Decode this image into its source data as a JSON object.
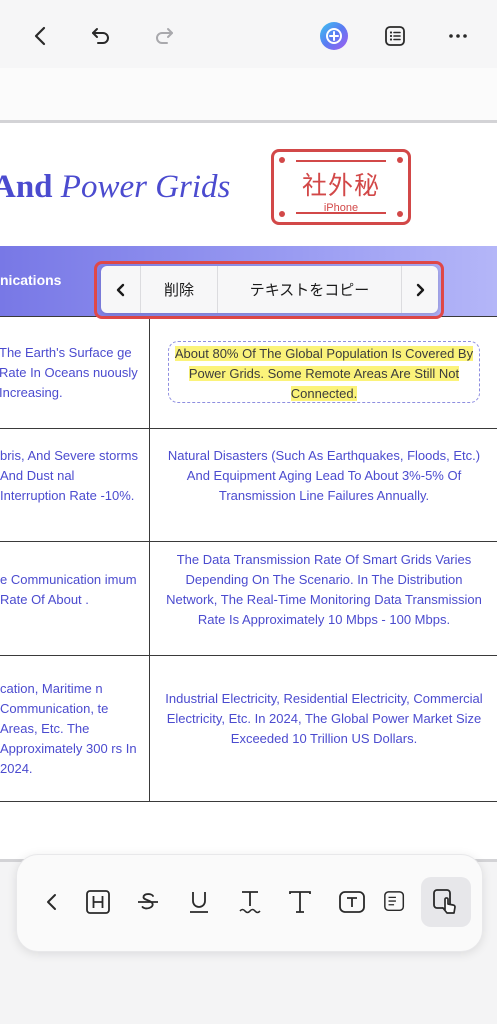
{
  "toolbar_top": {
    "back_icon": "chevron-left-icon",
    "undo_icon": "undo-icon",
    "redo_icon": "redo-icon",
    "ai_icon": "ai-assistant-icon",
    "outline_icon": "list-icon",
    "more_icon": "more-icon"
  },
  "document": {
    "heading_bold": "And",
    "heading_italic": "Power Grids",
    "stamp_main": "社外秘",
    "stamp_sub": "iPhone",
    "table_header_left": "nications",
    "rows": [
      {
        "left": "The Earth's Surface ge Rate In Oceans nuously Increasing.",
        "right": "About 80% Of The Global Population Is Covered By Power Grids. Some Remote Areas Are Still Not Connected."
      },
      {
        "left": "bris, And Severe storms And Dust nal Interruption Rate -10%.",
        "right": "Natural Disasters (Such As Earthquakes, Floods, Etc.) And Equipment Aging Lead To About 3%-5% Of Transmission Line Failures Annually."
      },
      {
        "left": "e Communication imum Rate Of About .",
        "right": "The Data Transmission Rate Of Smart Grids Varies Depending On The Scenario. In The Distribution Network, The Real-Time Monitoring Data Transmission Rate Is Approximately 10 Mbps - 100 Mbps."
      },
      {
        "left": "cation, Maritime n Communication, te Areas, Etc. The Approximately 300 rs In 2024.",
        "right": "Industrial Electricity, Residential Electricity, Commercial Electricity, Etc. In 2024, The Global Power Market Size Exceeded 10 Trillion US Dollars."
      }
    ]
  },
  "context_menu": {
    "prev": "‹",
    "delete": "削除",
    "copy_text": "テキストをコピー",
    "next": "›"
  },
  "bottom_toolbar": {
    "tools": [
      "chevron-left-icon",
      "heading-icon",
      "strikethrough-icon",
      "underline-icon",
      "squiggly-underline-icon",
      "text-icon",
      "textbox-icon",
      "callout-icon",
      "select-tool-icon"
    ]
  },
  "colors": {
    "accent": "#4b4bcf",
    "stamp": "#d24848",
    "highlight": "#fbf37a",
    "menu_border": "#e04848"
  }
}
